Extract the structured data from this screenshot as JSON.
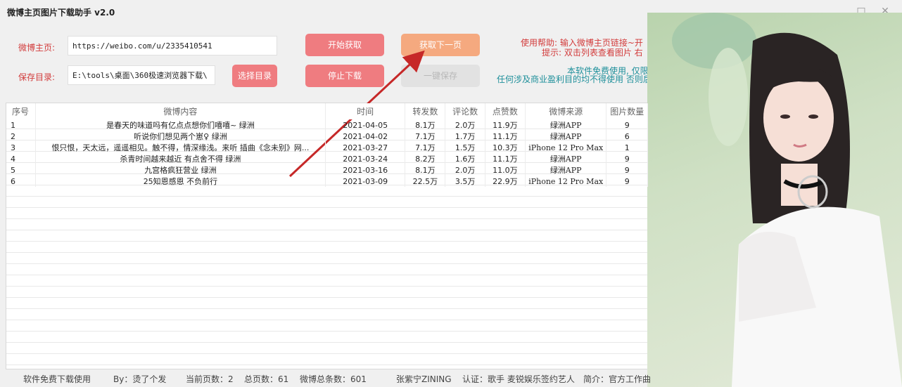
{
  "window": {
    "title": "微博主页图片下载助手 v2.0",
    "minimize": "□",
    "close": "✕"
  },
  "form": {
    "home_label": "微博主页:",
    "home_value": "https://weibo.com/u/2335410541",
    "dir_label": "保存目录:",
    "dir_value": "E:\\tools\\桌面\\360极速浏览器下载\\",
    "choose_dir": "选择目录"
  },
  "buttons": {
    "start": "开始获取",
    "next": "获取下一页",
    "stop": "停止下载",
    "save": "一键保存"
  },
  "help": {
    "line1": "使用帮助:  输入微博主页链接~开",
    "line2": "提示:  双击列表查看图片 右",
    "line3": "本软件免费使用, 仅限",
    "line4": "任何涉及商业盈利目的均不得使用 否则后"
  },
  "table": {
    "columns": [
      "序号",
      "微博内容",
      "时间",
      "转发数",
      "评论数",
      "点赞数",
      "微博来源",
      "图片数量"
    ],
    "rows": [
      [
        "1",
        "是春天的味道吗有亿点点想你们嘻嘻~ 绿洲",
        "2021-04-05",
        "8.1万",
        "2.0万",
        "11.9万",
        "绿洲APP",
        "9"
      ],
      [
        "2",
        "听说你们想见两个崽♀ 绿洲",
        "2021-04-02",
        "7.1万",
        "1.7万",
        "11.1万",
        "绿洲APP",
        "6"
      ],
      [
        "3",
        "恨只恨，天太远，遥遥相见。触不得，情深缘浅。来听 插曲《念未别》网...",
        "2021-03-27",
        "7.1万",
        "1.5万",
        "10.3万",
        "iPhone 12 Pro Max",
        "1"
      ],
      [
        "4",
        "杀青时间越来越近 有点舍不得 绿洲",
        "2021-03-24",
        "8.2万",
        "1.6万",
        "11.1万",
        "绿洲APP",
        "9"
      ],
      [
        "5",
        "九宫格疯狂营业 绿洲",
        "2021-03-16",
        "8.1万",
        "2.0万",
        "11.0万",
        "绿洲APP",
        "9"
      ],
      [
        "6",
        "25知恩感恩 不负前行",
        "2021-03-09",
        "22.5万",
        "3.5万",
        "22.9万",
        "iPhone 12 Pro Max",
        "9"
      ]
    ]
  },
  "status": {
    "free": "软件免费下载使用",
    "by": "By：烫了个发",
    "current_page": "当前页数：2",
    "total_pages": "总页数：61",
    "total_posts": "微博总条数：601",
    "name": "张紫宁ZINING",
    "verify": "认证：歌手 麦锐娱乐签约艺人",
    "intro": "简介：官方工作曲"
  },
  "colors": {
    "accent_red": "#ef7c80",
    "accent_orange": "#f5a97f",
    "label_red": "#d23b3b",
    "help_teal": "#1d8f9a",
    "arrow": "#c62828"
  },
  "icons": {
    "arrow": "red-annotation-arrow"
  }
}
